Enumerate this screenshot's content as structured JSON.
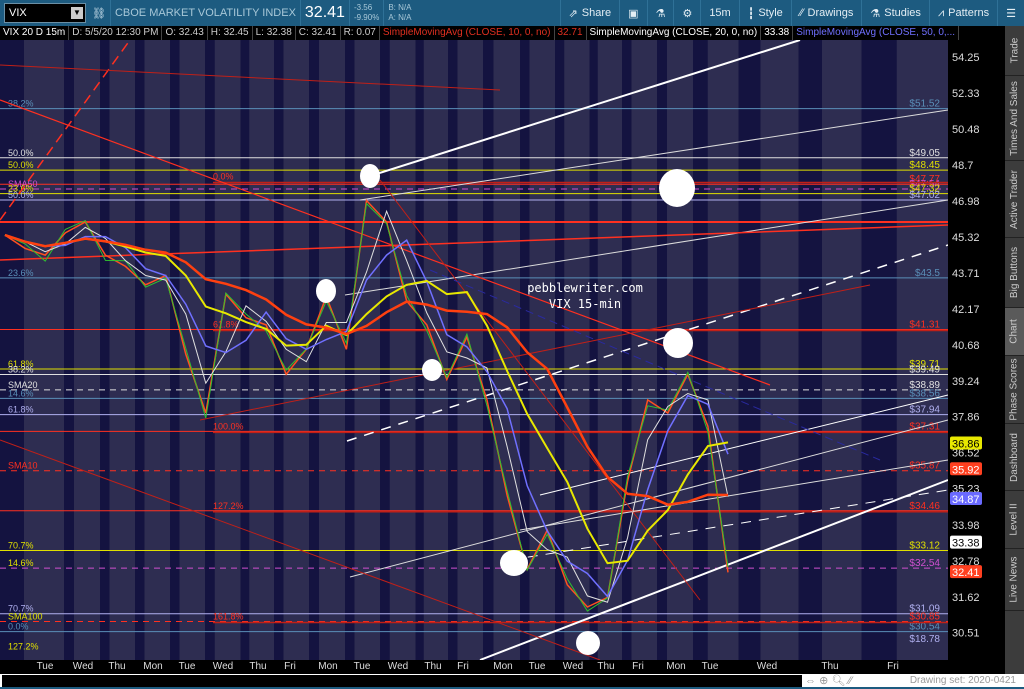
{
  "toolbar": {
    "symbol": "VIX",
    "description": "CBOE MARKET VOLATILITY INDEX",
    "last": "32.41",
    "change": "-3.56",
    "change_pct": "-9.90%",
    "bid": "B: N/A",
    "ask": "A: N/A",
    "buttons": [
      {
        "label": "Share",
        "icon": "share-icon"
      },
      {
        "label": "",
        "icon": "alert-icon"
      },
      {
        "label": "",
        "icon": "flask-icon"
      },
      {
        "label": "",
        "icon": "gear-icon"
      },
      {
        "label": "15m",
        "icon": ""
      },
      {
        "label": "Style",
        "icon": "candle-icon"
      },
      {
        "label": "Drawings",
        "icon": "pencil-icon"
      },
      {
        "label": "Studies",
        "icon": "flask-icon"
      },
      {
        "label": "Patterns",
        "icon": "pattern-icon"
      },
      {
        "label": "",
        "icon": "menu-icon"
      }
    ]
  },
  "legend": [
    {
      "text": "VIX 20 D 15m",
      "color": "#ffffff"
    },
    {
      "text": "D: 5/5/20 12:30 PM",
      "color": "#cccccc"
    },
    {
      "text": "O: 32.43",
      "color": "#cccccc"
    },
    {
      "text": "H: 32.45",
      "color": "#cccccc"
    },
    {
      "text": "L: 32.38",
      "color": "#cccccc"
    },
    {
      "text": "C: 32.41",
      "color": "#cccccc"
    },
    {
      "text": "R: 0.07",
      "color": "#cccccc"
    },
    {
      "text": "SimpleMovingAvg (CLOSE, 10, 0, no)",
      "color": "#e03020"
    },
    {
      "text": "32.71",
      "color": "#e03020"
    },
    {
      "text": "SimpleMovingAvg (CLOSE, 20, 0, no)",
      "color": "#ffffff"
    },
    {
      "text": "33.38",
      "color": "#ffffff"
    },
    {
      "text": "SimpleMovingAvg (CLOSE, 50, 0,...",
      "color": "#7070ff"
    }
  ],
  "chart": {
    "watermark_line1": "pebblewriter.com",
    "watermark_line2": "VIX 15-min",
    "y_scale": "log",
    "y_ticks": [
      "54.25",
      "52.33",
      "50.48",
      "48.7",
      "46.98",
      "45.32",
      "43.71",
      "42.17",
      "40.68",
      "39.24",
      "37.86",
      "36.52",
      "35.23",
      "33.98",
      "32.78",
      "31.62",
      "30.51"
    ],
    "x_ticks": [
      "Tue",
      "Wed",
      "Thu",
      "Mon",
      "Tue",
      "Wed",
      "Thu",
      "Fri",
      "Mon",
      "Tue",
      "Wed",
      "Thu",
      "Fri",
      "Mon",
      "Tue",
      "Wed",
      "Thu",
      "Fri",
      "Mon",
      "Tue",
      "Wed",
      "Thu",
      "Fri"
    ],
    "price_path": [
      45.4,
      44.8,
      44.5,
      45.5,
      46.0,
      44.5,
      44.0,
      43.2,
      43.6,
      40.3,
      38.0,
      42.8,
      41.8,
      41.5,
      39.5,
      40.5,
      42.7,
      40.5,
      47.0,
      46.0,
      42.5,
      41.5,
      39.3,
      41.0,
      38.5,
      35.0,
      32.5,
      33.8,
      32.0,
      31.3,
      31.6,
      35.5,
      38.5,
      38.0,
      39.5,
      37.5,
      32.4
    ],
    "levels": [
      {
        "price": 51.52,
        "label": "$51.52",
        "color": "#5a8fb8",
        "style": "solid"
      },
      {
        "price": 49.05,
        "label": "$49.05",
        "color": "#e0e0e0",
        "style": "solid"
      },
      {
        "price": 48.45,
        "label": "$48.45",
        "color": "#e0e000",
        "style": "solid"
      },
      {
        "price": 47.77,
        "label": "$47.77",
        "color": "#ff3020",
        "style": "solid"
      },
      {
        "price": 47.54,
        "label": "$47.54",
        "color": "#d050d0",
        "style": "dashed"
      },
      {
        "price": 47.32,
        "label": "$47.32",
        "color": "#e0e000",
        "style": "solid"
      },
      {
        "price": 47.02,
        "label": "$47.02",
        "color": "#b0b0f0",
        "style": "solid"
      },
      {
        "price": 46.0,
        "label": "",
        "color": "#ff3020",
        "style": "solid"
      },
      {
        "price": 43.5,
        "label": "$43.5",
        "color": "#5a8fb8",
        "style": "solid"
      },
      {
        "price": 41.31,
        "label": "$41.31",
        "color": "#ff3020",
        "style": "solid"
      },
      {
        "price": 39.71,
        "label": "$39.71",
        "color": "#e0e000",
        "style": "solid"
      },
      {
        "price": 39.49,
        "label": "$39.49",
        "color": "#e0e0e0",
        "style": "solid"
      },
      {
        "price": 38.89,
        "label": "$38.89",
        "color": "#e0e0e0",
        "style": "dashed"
      },
      {
        "price": 38.56,
        "label": "$38.56",
        "color": "#5a8fb8",
        "style": "solid"
      },
      {
        "price": 37.94,
        "label": "$37.94",
        "color": "#b0b0f0",
        "style": "solid"
      },
      {
        "price": 37.31,
        "label": "$37.31",
        "color": "#ff3020",
        "style": "solid"
      },
      {
        "price": 35.87,
        "label": "$35.87",
        "color": "#ff3020",
        "style": "dashed"
      },
      {
        "price": 34.46,
        "label": "$34.46",
        "color": "#ff3020",
        "style": "solid"
      },
      {
        "price": 33.12,
        "label": "$33.12",
        "color": "#e0e000",
        "style": "solid"
      },
      {
        "price": 32.54,
        "label": "$32.54",
        "color": "#d050d0",
        "style": "dashed"
      },
      {
        "price": 31.09,
        "label": "$31.09",
        "color": "#b0b0f0",
        "style": "solid"
      },
      {
        "price": 30.85,
        "label": "$30.85",
        "color": "#ff3020",
        "style": "dashed"
      },
      {
        "price": 30.54,
        "label": "$30.54",
        "color": "#5a8fb8",
        "style": "solid"
      }
    ],
    "bottom_label": "$18.78",
    "left_labels": [
      {
        "price": 51.52,
        "text": "38.2%",
        "color": "#5a8fb8"
      },
      {
        "price": 49.05,
        "text": "50.0%",
        "color": "#e0e0e0"
      },
      {
        "price": 48.45,
        "text": "50.0%",
        "color": "#e0e000"
      },
      {
        "price": 47.54,
        "text": "SMA50",
        "color": "#d050d0"
      },
      {
        "price": 47.32,
        "text": "23.6%",
        "color": "#e0e000"
      },
      {
        "price": 47.02,
        "text": "50.0%",
        "color": "#b0b0f0"
      },
      {
        "price": 43.5,
        "text": "23.6%",
        "color": "#5a8fb8"
      },
      {
        "price": 39.71,
        "text": "61.8%",
        "color": "#e0e000"
      },
      {
        "price": 39.49,
        "text": "38.2%",
        "color": "#e0e0e0"
      },
      {
        "price": 38.89,
        "text": "SMA20",
        "color": "#e0e0e0"
      },
      {
        "price": 38.56,
        "text": "14.6%",
        "color": "#5a8fb8"
      },
      {
        "price": 37.94,
        "text": "61.8%",
        "color": "#b0b0f0"
      },
      {
        "price": 35.87,
        "text": "SMA10",
        "color": "#ff3020"
      },
      {
        "price": 33.12,
        "text": "70.7%",
        "color": "#e0e000"
      },
      {
        "price": 32.54,
        "text": "14.6%",
        "color": "#e0e000"
      },
      {
        "price": 31.09,
        "text": "70.7%",
        "color": "#b0b0f0"
      },
      {
        "price": 30.85,
        "text": "SMA100",
        "color": "#e0e000"
      },
      {
        "price": 30.54,
        "text": "0.0%",
        "color": "#5a8fb8"
      },
      {
        "price": 27.2,
        "text": "127.2%",
        "color": "#e0e000"
      }
    ],
    "fib_labels": [
      {
        "price": 47.9,
        "text": "0.0%"
      },
      {
        "price": 41.31,
        "text": "61.8%"
      },
      {
        "price": 37.31,
        "text": "100.0%"
      },
      {
        "price": 34.46,
        "text": "127.2%"
      },
      {
        "price": 30.85,
        "text": "161.8%"
      }
    ],
    "price_tags": [
      {
        "text": "36.86",
        "bg": "#e8e800",
        "fg": "#000"
      },
      {
        "text": "35.92",
        "bg": "#ff4020",
        "fg": "#fff"
      },
      {
        "text": "34.87",
        "bg": "#6a6aff",
        "fg": "#fff"
      },
      {
        "text": "33.38",
        "bg": "#ffffff",
        "fg": "#000"
      },
      {
        "text": "32.41",
        "bg": "#ff4020",
        "fg": "#fff"
      }
    ]
  },
  "sidebar": [
    "Trade",
    "Times And Sales",
    "Active Trader",
    "Big Buttons",
    "Chart",
    "Phase Scores",
    "Dashboard",
    "Level II",
    "Live News"
  ],
  "sidebar_active": "Chart",
  "footer": {
    "drawing_set": "Drawing set: 2020-0421"
  }
}
